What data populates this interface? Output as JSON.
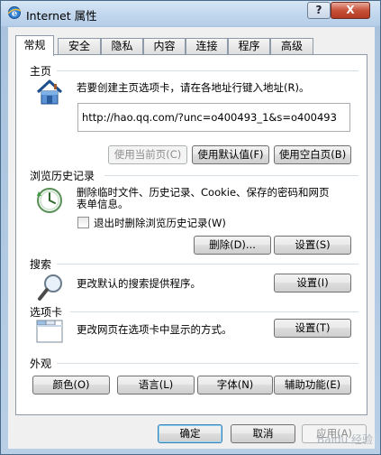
{
  "window": {
    "title": "Internet 属性",
    "help_label": "?",
    "close_label": "X"
  },
  "tabs": [
    {
      "label": "常规",
      "active": true
    },
    {
      "label": "安全"
    },
    {
      "label": "隐私"
    },
    {
      "label": "内容"
    },
    {
      "label": "连接"
    },
    {
      "label": "程序"
    },
    {
      "label": "高级"
    }
  ],
  "home": {
    "section_title": "主页",
    "description": "若要创建主页选项卡，请在各地址行键入地址(R)。",
    "url": "http://hao.qq.com/?unc=o400493_1&s=o400493",
    "btn_current": "使用当前页(C)",
    "btn_default": "使用默认值(F)",
    "btn_blank": "使用空白页(B)"
  },
  "history": {
    "section_title": "浏览历史记录",
    "description_line1": "删除临时文件、历史记录、Cookie、保存的密码和网页",
    "description_line2": "表单信息。",
    "checkbox_label": "退出时删除浏览历史记录(W)",
    "checkbox_checked": false,
    "btn_delete": "删除(D)...",
    "btn_settings": "设置(S)"
  },
  "search": {
    "section_title": "搜索",
    "description": "更改默认的搜索提供程序。",
    "btn_settings": "设置(I)"
  },
  "tabs_section": {
    "section_title": "选项卡",
    "description": "更改网页在选项卡中显示的方式。",
    "btn_settings": "设置(T)"
  },
  "appearance": {
    "section_title": "外观",
    "btn_colors": "颜色(O)",
    "btn_languages": "语言(L)",
    "btn_fonts": "字体(N)",
    "btn_accessibility": "辅助功能(E)"
  },
  "footer": {
    "btn_ok": "确定",
    "btn_cancel": "取消",
    "btn_apply": "应用(A)"
  },
  "watermark": "Baidu 经验"
}
